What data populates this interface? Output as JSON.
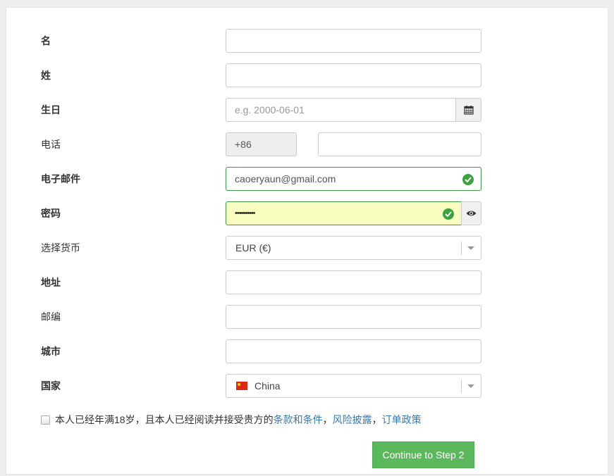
{
  "form": {
    "first_name": {
      "label": "名",
      "value": ""
    },
    "last_name": {
      "label": "姓",
      "value": ""
    },
    "birthday": {
      "label": "生日",
      "placeholder": "e.g. 2000-06-01",
      "value": "",
      "icon": "calendar-icon"
    },
    "phone": {
      "label": "电话",
      "country_code": "+86",
      "value": ""
    },
    "email": {
      "label": "电子邮件",
      "value": "caoeryaun@gmail.com",
      "status": "valid"
    },
    "password": {
      "label": "密码",
      "value": "••••••••••",
      "status": "valid",
      "toggle_icon": "eye-icon"
    },
    "currency": {
      "label": "选择货币",
      "selected": "EUR (€)"
    },
    "address": {
      "label": "地址",
      "value": ""
    },
    "postcode": {
      "label": "邮编",
      "value": ""
    },
    "city": {
      "label": "城市",
      "value": ""
    },
    "country": {
      "label": "国家",
      "selected": "China",
      "flag": "cn-flag-icon"
    }
  },
  "terms": {
    "text": "本人已经年满18岁，且本人已经阅读并接受贵方的",
    "link1": "条款和条件",
    "sep1": "，",
    "link2": "风险披露",
    "sep2": "，",
    "link3": "订单政策",
    "checked": false
  },
  "submit_label": "Continue to Step 2",
  "colors": {
    "success": "#5cb85c",
    "valid_border": "#3c9a45",
    "link": "#337ab7",
    "autofill": "#fafdc0"
  }
}
